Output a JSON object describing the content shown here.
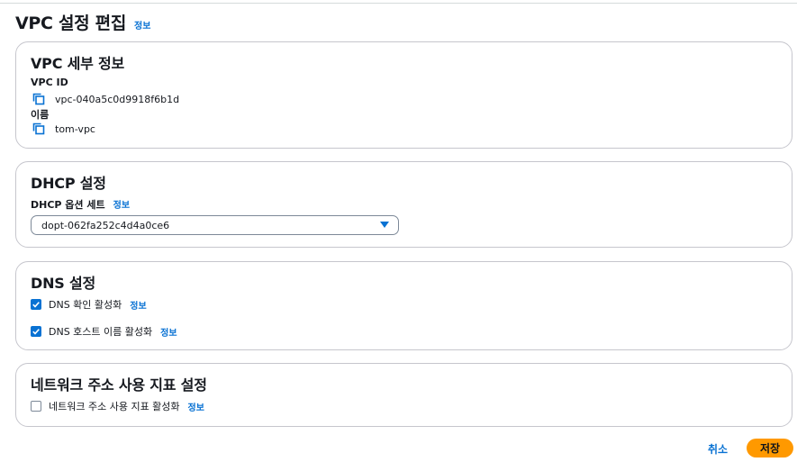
{
  "header": {
    "title": "VPC 설정 편집",
    "info_label": "정보"
  },
  "vpc_details": {
    "title": "VPC 세부 정보",
    "vpc_id_label": "VPC ID",
    "vpc_id_value": "vpc-040a5c0d9918f6b1d",
    "name_label": "이름",
    "name_value": "tom-vpc"
  },
  "dhcp": {
    "title": "DHCP 설정",
    "option_set_label": "DHCP 옵션 세트",
    "info_label": "정보",
    "selected_value": "dopt-062fa252c4d4a0ce6"
  },
  "dns": {
    "title": "DNS 설정",
    "resolution_label": "DNS 확인 활성화",
    "resolution_checked": true,
    "hostnames_label": "DNS 호스트 이름 활성화",
    "hostnames_checked": true,
    "info_label": "정보"
  },
  "network_metrics": {
    "title": "네트워크 주소 사용 지표 설정",
    "enable_label": "네트워크 주소 사용 지표 활성화",
    "enable_checked": false,
    "info_label": "정보"
  },
  "actions": {
    "cancel_label": "취소",
    "save_label": "저장"
  },
  "colors": {
    "link": "#0972d3",
    "primary_button": "#ff9900",
    "border": "#c6c6cd"
  }
}
